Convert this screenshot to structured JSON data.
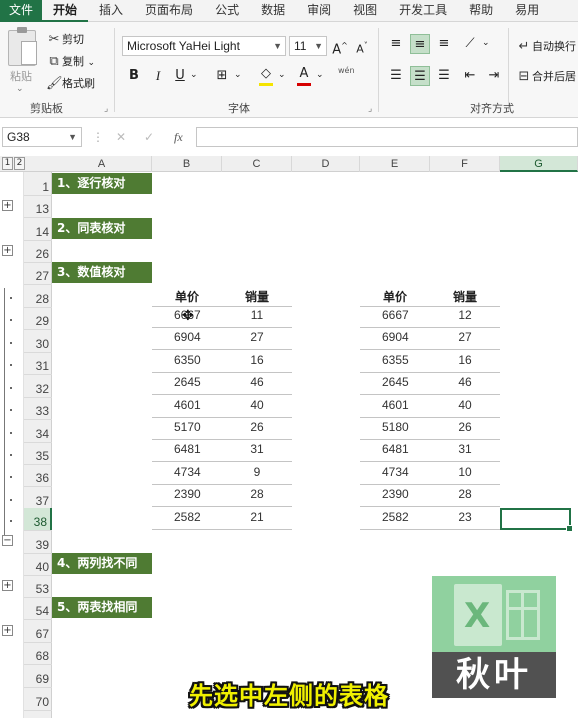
{
  "tabs": [
    "文件",
    "开始",
    "插入",
    "页面布局",
    "公式",
    "数据",
    "审阅",
    "视图",
    "开发工具",
    "帮助",
    "易用"
  ],
  "clipboard": {
    "paste": "粘贴",
    "cut": "剪切",
    "copy": "复制",
    "format_painter": "格式刷",
    "group_label": "剪贴板"
  },
  "font": {
    "name": "Microsoft YaHei Light",
    "size": "11",
    "grow": "A^",
    "shrink": "A˅",
    "bold": "B",
    "italic": "I",
    "underline": "U",
    "wen": "wén",
    "group_label": "字体"
  },
  "alignment": {
    "wrap_text": "自动换行",
    "merge_center": "合并后居",
    "group_label": "对齐方式"
  },
  "formula_bar": {
    "name_box": "G38",
    "cancel": "✕",
    "confirm": "✓",
    "fx": "fx",
    "value": ""
  },
  "outline_levels": [
    "1",
    "2"
  ],
  "columns": [
    "A",
    "B",
    "C",
    "D",
    "E",
    "F",
    "G"
  ],
  "rows": [
    "1",
    "13",
    "14",
    "26",
    "27",
    "28",
    "29",
    "30",
    "31",
    "32",
    "33",
    "34",
    "35",
    "36",
    "37",
    "38",
    "39",
    "40",
    "53",
    "54",
    "67",
    "68",
    "69",
    "70"
  ],
  "sections": [
    {
      "label": "1、逐行核对"
    },
    {
      "label": "2、同表核对"
    },
    {
      "label": "3、数值核对"
    },
    {
      "label": "4、两列找不同"
    },
    {
      "label": "5、两表找相同"
    }
  ],
  "left_table": {
    "headers": [
      "单价",
      "销量"
    ],
    "rows": [
      [
        "6667",
        "11"
      ],
      [
        "6904",
        "27"
      ],
      [
        "6350",
        "16"
      ],
      [
        "2645",
        "46"
      ],
      [
        "4601",
        "40"
      ],
      [
        "5170",
        "26"
      ],
      [
        "6481",
        "31"
      ],
      [
        "4734",
        "9"
      ],
      [
        "2390",
        "28"
      ],
      [
        "2582",
        "21"
      ]
    ]
  },
  "right_table": {
    "headers": [
      "单价",
      "销量"
    ],
    "rows": [
      [
        "6667",
        "12"
      ],
      [
        "6904",
        "27"
      ],
      [
        "6355",
        "16"
      ],
      [
        "2645",
        "46"
      ],
      [
        "4601",
        "40"
      ],
      [
        "5180",
        "26"
      ],
      [
        "6481",
        "31"
      ],
      [
        "4734",
        "10"
      ],
      [
        "2390",
        "28"
      ],
      [
        "2582",
        "23"
      ]
    ]
  },
  "watermark": {
    "text": "秋叶",
    "letter": "X"
  },
  "subtitle": "先选中左侧的表格"
}
